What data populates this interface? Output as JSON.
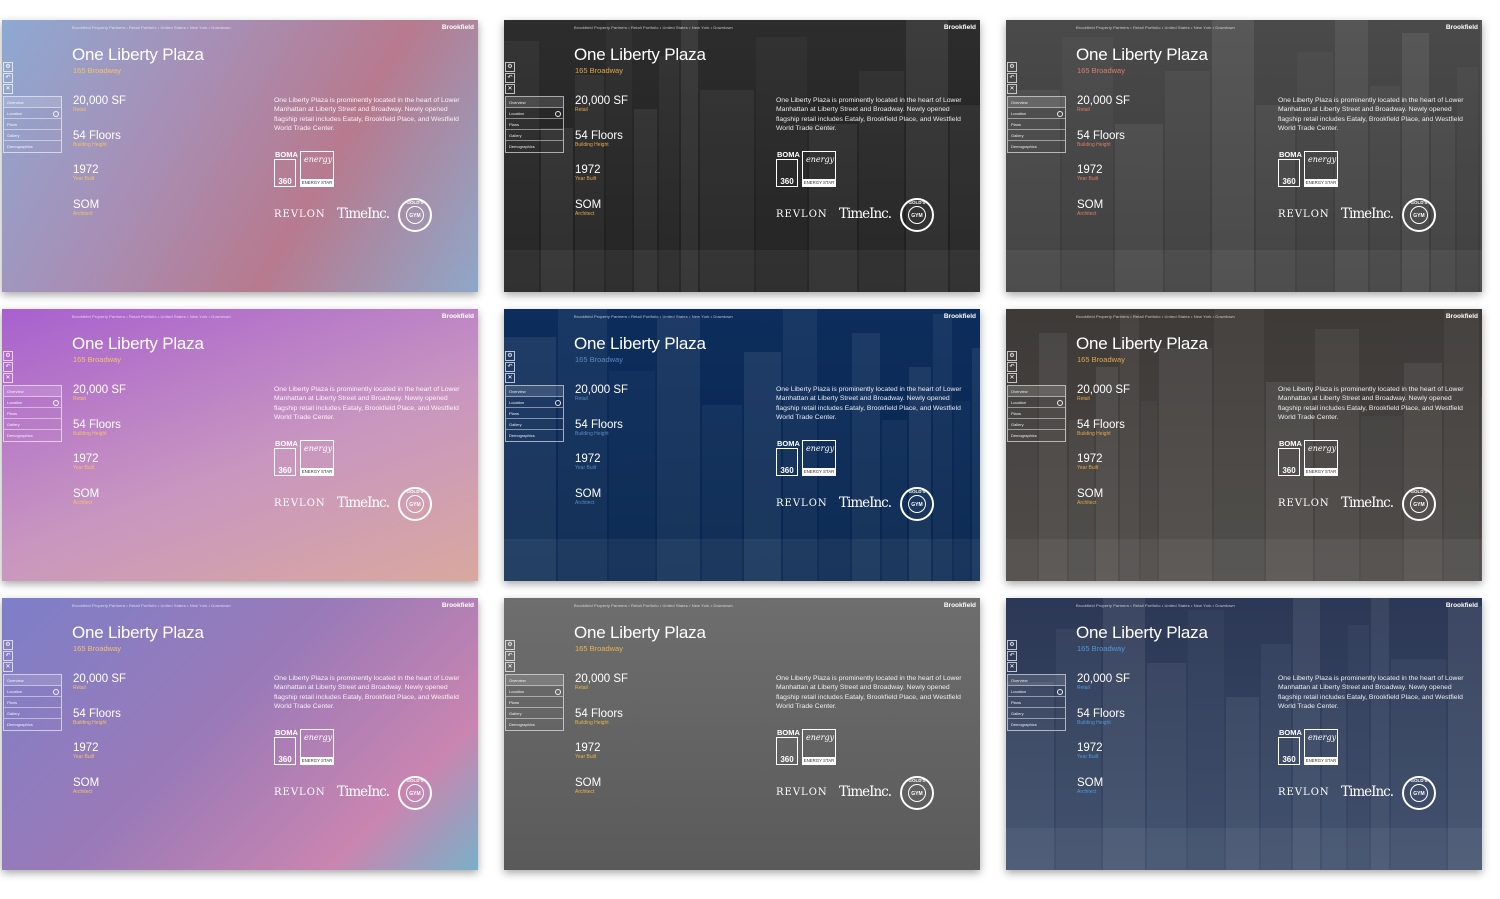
{
  "panels": [
    {
      "bg": "linear-gradient(120deg,#8da9d2 0%,#a78fb6 35%,#b77a8e 65%,#8fa7c9 100%)",
      "city": false,
      "accent": "#f4c26b"
    },
    {
      "bg": "linear-gradient(180deg,#2d2d2d,#1d1d1d)",
      "city": true,
      "accent": "#e0a84a"
    },
    {
      "bg": "linear-gradient(180deg,#4a4a4a,#3a3a3a)",
      "city": true,
      "accent": "#d9806a"
    },
    {
      "bg": "linear-gradient(160deg,#a860cf 0%,#c896c0 55%,#d9a89f 100%)",
      "city": false,
      "accent": "#f4c26b"
    },
    {
      "bg": "linear-gradient(180deg,#0d2d5c,#06254e)",
      "city": true,
      "accent": "#5a8ac0"
    },
    {
      "bg": "linear-gradient(180deg,#3d3a38,#4a4744)",
      "city": true,
      "accent": "#e0a84a"
    },
    {
      "bg": "linear-gradient(135deg,#7d7fc8 0%,#9a7ab8 45%,#c985b0 80%,#7ab0c8 100%)",
      "city": false,
      "accent": "#f4c26b"
    },
    {
      "bg": "linear-gradient(180deg,#6e6e6e,#5a5a5a)",
      "city": false,
      "accent": "#e6b54a"
    },
    {
      "bg": "linear-gradient(180deg,#2c3855,#3a4a68)",
      "city": true,
      "accent": "#4f9ad8"
    }
  ],
  "content": {
    "breadcrumb": "Brookfield Property Partners • Retail Portfolio • United States • New York • Downtown",
    "brand": "Brookfield",
    "title": "One Liberty Plaza",
    "address": "165 Broadway",
    "stats": [
      {
        "value": "20,000 SF",
        "label": "Retail"
      },
      {
        "value": "54 Floors",
        "label": "Building Height"
      },
      {
        "value": "1972",
        "label": "Year Built"
      },
      {
        "value": "SOM",
        "label": "Architect"
      }
    ],
    "description": "One Liberty Plaza is prominently located in the heart of Lower Manhattan at Liberty Street and Broadway. Newly opened flagship retail includes Eataly, Brookfield Place, and Westfield World Trade Center.",
    "controls": [
      "⚙",
      "↶",
      "✕"
    ],
    "nav": [
      "Overview",
      "Location",
      "Plans",
      "Gallery",
      "Demographics"
    ],
    "cert_boma": "BOMA",
    "cert_boma_num": "360",
    "cert_energy": "energy",
    "cert_energy_star": "ENERGY STAR",
    "tenant_revlon": "REVLON",
    "tenant_time": "TimeInc.",
    "tenant_gold_outer": "GOLD'S",
    "tenant_gold_inner": "GYM"
  }
}
